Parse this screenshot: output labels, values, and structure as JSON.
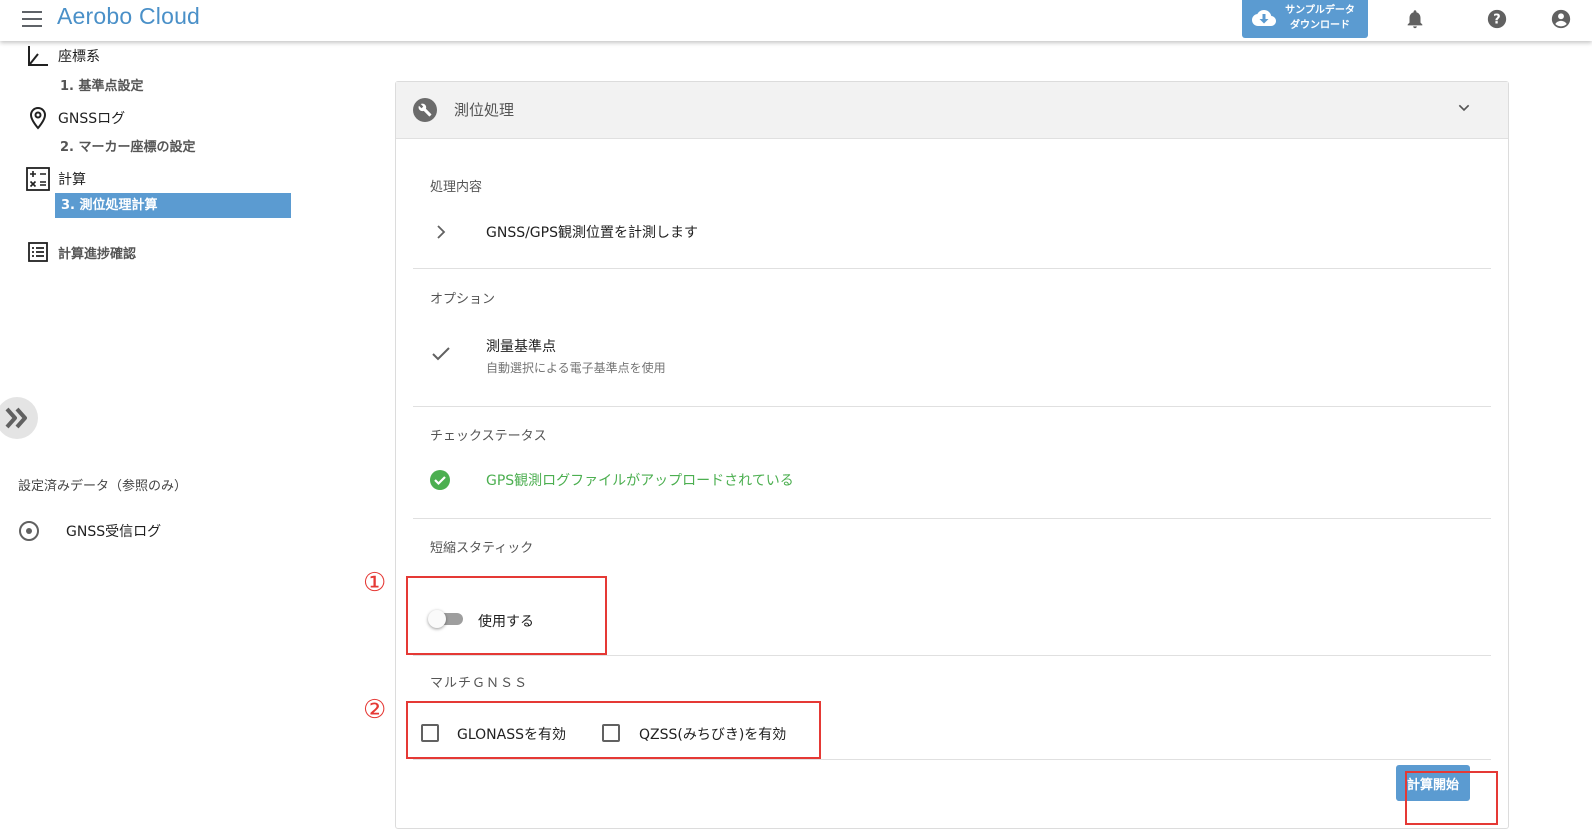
{
  "app": {
    "title": "Aerobo Cloud"
  },
  "topbar": {
    "sample_line1": "サンプルデータ",
    "sample_line2": "ダウンロード",
    "icons": [
      "bell-icon",
      "help-icon",
      "account-icon"
    ]
  },
  "sidebar": {
    "items": [
      {
        "label": "座標系",
        "icon": "axis-icon",
        "sub": "1. 基準点設定"
      },
      {
        "label": "GNSSログ",
        "icon": "location-pin-icon",
        "sub": "2. マーカー座標の設定"
      },
      {
        "label": "計算",
        "icon": "calculator-icon",
        "sub": "3. 測位処理計算"
      }
    ],
    "progress_label": "計算進捗確認",
    "ref_heading": "設定済みデータ（参照のみ）",
    "ref_item": "GNSS受信ログ"
  },
  "card": {
    "title": "測位処理",
    "processing": {
      "heading": "処理内容",
      "text": "GNSS/GPS観測位置を計測します"
    },
    "options": {
      "heading": "オプション",
      "title": "測量基準点",
      "subtitle": "自動選択による電子基準点を使用"
    },
    "check": {
      "heading": "チェックステータス",
      "text": "GPS観測ログファイルがアップロードされている"
    },
    "static": {
      "heading": "短縮スタティック",
      "toggle_label": "使用する",
      "toggle_on": false
    },
    "multi": {
      "heading": "マルチＧＮＳＳ",
      "glonass": "GLONASSを有効",
      "qzss": "QZSS(みちびき)を有効"
    },
    "start_button": "計算開始"
  },
  "annotations": {
    "one": "①",
    "two": "②"
  },
  "colors": {
    "accent": "#5b9bd1",
    "title": "#4a90c8",
    "ok": "#4caf50",
    "annotation": "#e53935"
  }
}
